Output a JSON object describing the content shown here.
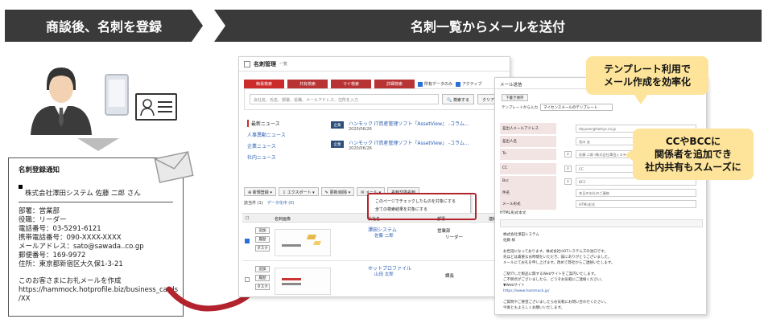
{
  "banners": {
    "left": "商談後、名刺を登録",
    "right": "名刺一覧からメールを送付"
  },
  "registration_email": {
    "subject": "名刺登録通知",
    "company_line": "株式会社澤田システム 佐藤 二郎 さん",
    "lines": [
      "部署：営業部",
      "役職：リーダー",
      "電話番号：03-5291-6121",
      "携帯電話番号：090-XXXX-XXXX",
      "メールアドレス：sato@sawada..co.gp",
      "郵便番号：169-9972",
      "住所：東京都新宿区大久保1-3-21"
    ],
    "footer_lines": [
      "このお客さまにお礼メールを作成",
      "https://hammock.hotprofile.biz/business_cards",
      "/XX"
    ]
  },
  "app": {
    "title": "名刺管理",
    "subtitle": "一覧",
    "tabs": [
      "簡易検索",
      "共有検索",
      "マイ検索",
      "詳細検索"
    ],
    "checkboxes": [
      "所有データのみ",
      "アクティブ"
    ],
    "search_placeholder": "会社名、氏名、部署、役職、メールアドレス、住所を入力",
    "search_button": "検索する",
    "clear_button": "クリア",
    "news_nav": [
      "最新ニュース",
      "人事異動ニュース",
      "企業ニュース",
      "社内ニュース"
    ],
    "news": [
      {
        "tag": "企業",
        "title": "ハンモック IT資産管理ソフト『AssetView』 -コラム...",
        "date": "2020/06/26"
      },
      {
        "tag": "企業",
        "title": "ハンモック IT資産管理ソフト『AssetView』 -コラム...",
        "date": "2020/06/26"
      }
    ],
    "toolbar": [
      "新規登録",
      "エクスポート",
      "更新/削除",
      "メール",
      "名刺交換名刺"
    ],
    "count_text": "該当件 (1)",
    "count_link": "データ化中 (0)",
    "popup": [
      "このページでチェックしたものを対象にする",
      "全ての検索結果を対象にする"
    ],
    "grid_headers": [
      "名刺画像",
      "会社名",
      "部署",
      "連絡"
    ],
    "row_buttons": [
      "追加",
      "履歴",
      "タスク"
    ],
    "rows": [
      {
        "company": "澤田システム",
        "person": "佐藤 二郎",
        "dept": "営業部",
        "position": "リーダー",
        "checked": true
      },
      {
        "company": "ホットプロファイル",
        "person": "山田 太郎",
        "dept": "",
        "position": "課長",
        "checked": false
      }
    ]
  },
  "mail": {
    "header": "メール送信",
    "template_button": "下書き保存",
    "template_label": "テンプレートから入力",
    "template_value": "マイセンスメールのテンプレート",
    "fields": [
      {
        "label": "差出人メールアドレス",
        "value": "dayuser@hotsys.co.jp"
      },
      {
        "label": "差出人名",
        "value": "池口 圭"
      },
      {
        "label": "To",
        "value": "佐藤 二郎 (株式会社澤田システム) <sato>"
      },
      {
        "label": "CC",
        "value": "CC"
      },
      {
        "label": "Bcc",
        "value": "BCC"
      },
      {
        "label": "件名",
        "value": "本日のお礼のご連絡"
      },
      {
        "label": "メール形式",
        "value": "HTML形式"
      }
    ],
    "editor_tab": "HTML形式本文",
    "body_lines": [
      "株式会社澤田システム",
      "佐藤 様",
      "",
      "お世話になっております。株式会社HOTシステムズの池口です。",
      "先ほどは貴重なお時間をいただき、誠にありがとうございました。",
      "メールにてお礼を申し上げます。改めて弊社からご連絡いたします。",
      "",
      "ご紹介した製品に関するWebサイトをご案内いたします。",
      "ご不明点がございましたら、どうぞお気軽にご連絡ください。",
      "▼Webサイト",
      "https://www.hammock.jp/",
      "",
      "ご質問やご要望ございましたらお気軽にお問い合わせください。",
      "今後ともよろしくお願いいたします。"
    ]
  },
  "callouts": {
    "template": [
      "テンプレート利用で",
      "メール作成を効率化"
    ],
    "cc": [
      "CCやBCCに",
      "関係者を追加でき",
      "社内共有もスムーズに"
    ]
  },
  "colors": {
    "banner": "#3a3a3a",
    "accent_red": "#cc2b2b",
    "callout": "#fde49a",
    "link": "#2a5db0"
  }
}
